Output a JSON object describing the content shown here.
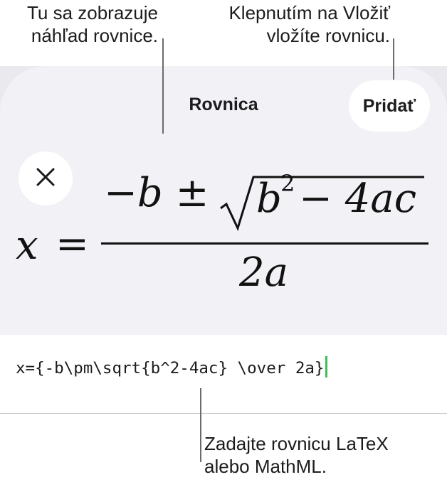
{
  "callouts": {
    "preview_line1": "Tu sa zobrazuje",
    "preview_line2": "náhľad rovnice.",
    "insert_line1": "Klepnutím na Vložiť",
    "insert_line2": "vložíte rovnicu.",
    "input_line1": "Zadajte rovnicu LaTeX",
    "input_line2": "alebo MathML."
  },
  "sheet": {
    "title": "Rovnica",
    "add_label": "Pridať",
    "close_icon": "close-icon"
  },
  "equation": {
    "lhs": "x",
    "equals": "=",
    "numerator_prefix": "−b ±",
    "radicand_base": "b",
    "radicand_exponent": "2",
    "radicand_rest": " − 4ac",
    "denominator": "2a"
  },
  "input": {
    "value": "x={-b\\pm\\sqrt{b^2-4ac} \\over 2a}"
  },
  "colors": {
    "caret": "#3cc05a",
    "sheet_background": "#f2f2f6"
  }
}
